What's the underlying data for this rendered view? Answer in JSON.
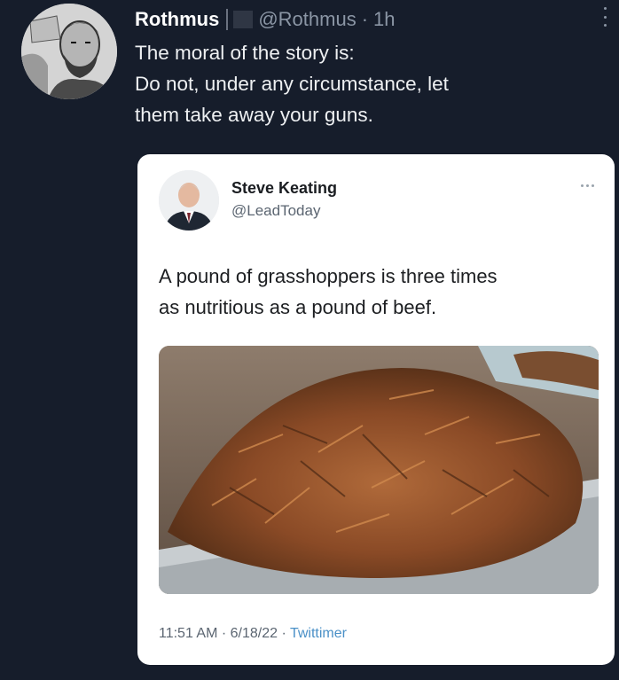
{
  "tweet": {
    "display_name": "Rothmus",
    "handle": "@Rothmus",
    "separator": "·",
    "time": "1h",
    "avatar_icon": "sketch-portrait-avatar",
    "body_lines": [
      "The moral of the story is:",
      "Do not, under any circumstance, let",
      "them take away your guns."
    ]
  },
  "quoted": {
    "display_name": "Steve Keating",
    "handle": "@LeadToday",
    "avatar_icon": "portrait-avatar",
    "text_lines": [
      "A pound of grasshoppers is three times",
      "as nutritious as a pound of beef."
    ],
    "media_icon": "grasshoppers-tray-photo",
    "footer": {
      "time": "11:51 AM",
      "sep1": " · ",
      "date": "6/18/22",
      "sep2": " · ",
      "app": "Twittimer"
    }
  },
  "colors": {
    "background": "#161d2b",
    "card": "#ffffff",
    "muted": "#8b96a5",
    "link": "#4a90c7"
  }
}
